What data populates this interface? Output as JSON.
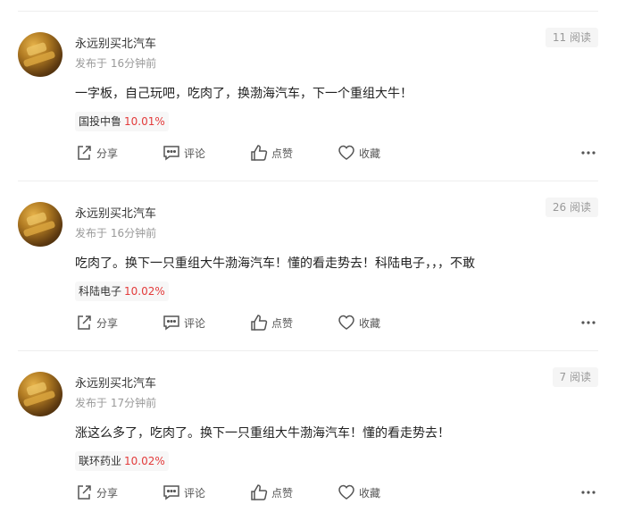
{
  "posts": [
    {
      "username": "永远别买北汽车",
      "time": "发布于 16分钟前",
      "reads": "11 阅读",
      "content": "一字板，自己玩吧，吃肉了，换渤海汽车，下一个重组大牛！",
      "stock": {
        "name": "国投中鲁",
        "change": "10.01%"
      },
      "actions": {
        "share": "分享",
        "comment": "评论",
        "like": "点赞",
        "favorite": "收藏"
      }
    },
    {
      "username": "永远别买北汽车",
      "time": "发布于 16分钟前",
      "reads": "26 阅读",
      "content": "吃肉了。换下一只重组大牛渤海汽车！懂的看走势去！科陆电子，，，不敢",
      "stock": {
        "name": "科陆电子",
        "change": "10.02%"
      },
      "actions": {
        "share": "分享",
        "comment": "评论",
        "like": "点赞",
        "favorite": "收藏"
      }
    },
    {
      "username": "永远别买北汽车",
      "time": "发布于 17分钟前",
      "reads": "7 阅读",
      "content": "涨这么多了，吃肉了。换下一只重组大牛渤海汽车！懂的看走势去！",
      "stock": {
        "name": "联环药业",
        "change": "10.02%"
      },
      "actions": {
        "share": "分享",
        "comment": "评论",
        "like": "点赞",
        "favorite": "收藏"
      }
    }
  ],
  "colors": {
    "up": "#e33b3b",
    "muted": "#999999",
    "divider": "#eeeeee"
  }
}
